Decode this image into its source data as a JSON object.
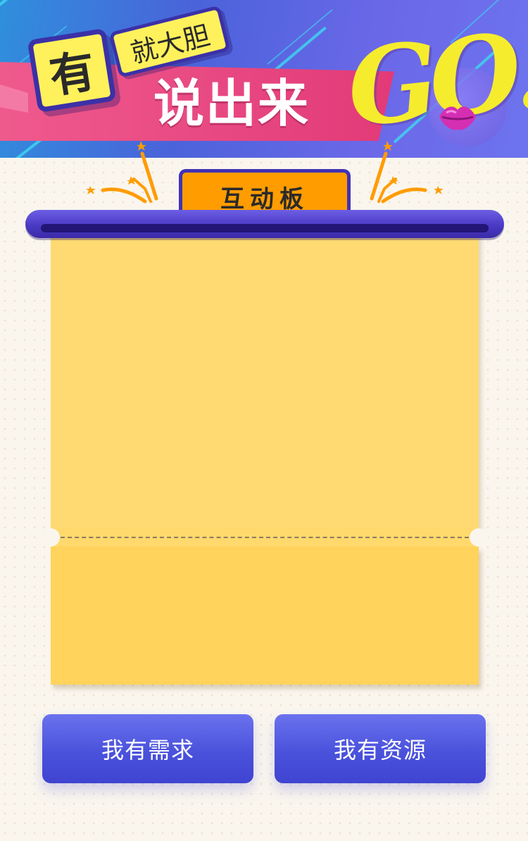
{
  "banner": {
    "you_char": "有",
    "jiu_text": "就大胆",
    "speak_text": "说出来",
    "go_text": "GO!!"
  },
  "board": {
    "tab_label": "互动板"
  },
  "actions": {
    "need_label": "我有需求",
    "resource_label": "我有资源"
  },
  "colors": {
    "banner_blue": "#4a63da",
    "ribbon_pink": "#e23a78",
    "card_yellow": "#fff15b",
    "tab_orange": "#ff9c00",
    "rod_purple": "#4a3ac4",
    "board_yellow": "#ffd971",
    "button_blue": "#4a52dc"
  },
  "icons": {
    "lips": "lips-icon",
    "stars": "star-burst-icon"
  }
}
